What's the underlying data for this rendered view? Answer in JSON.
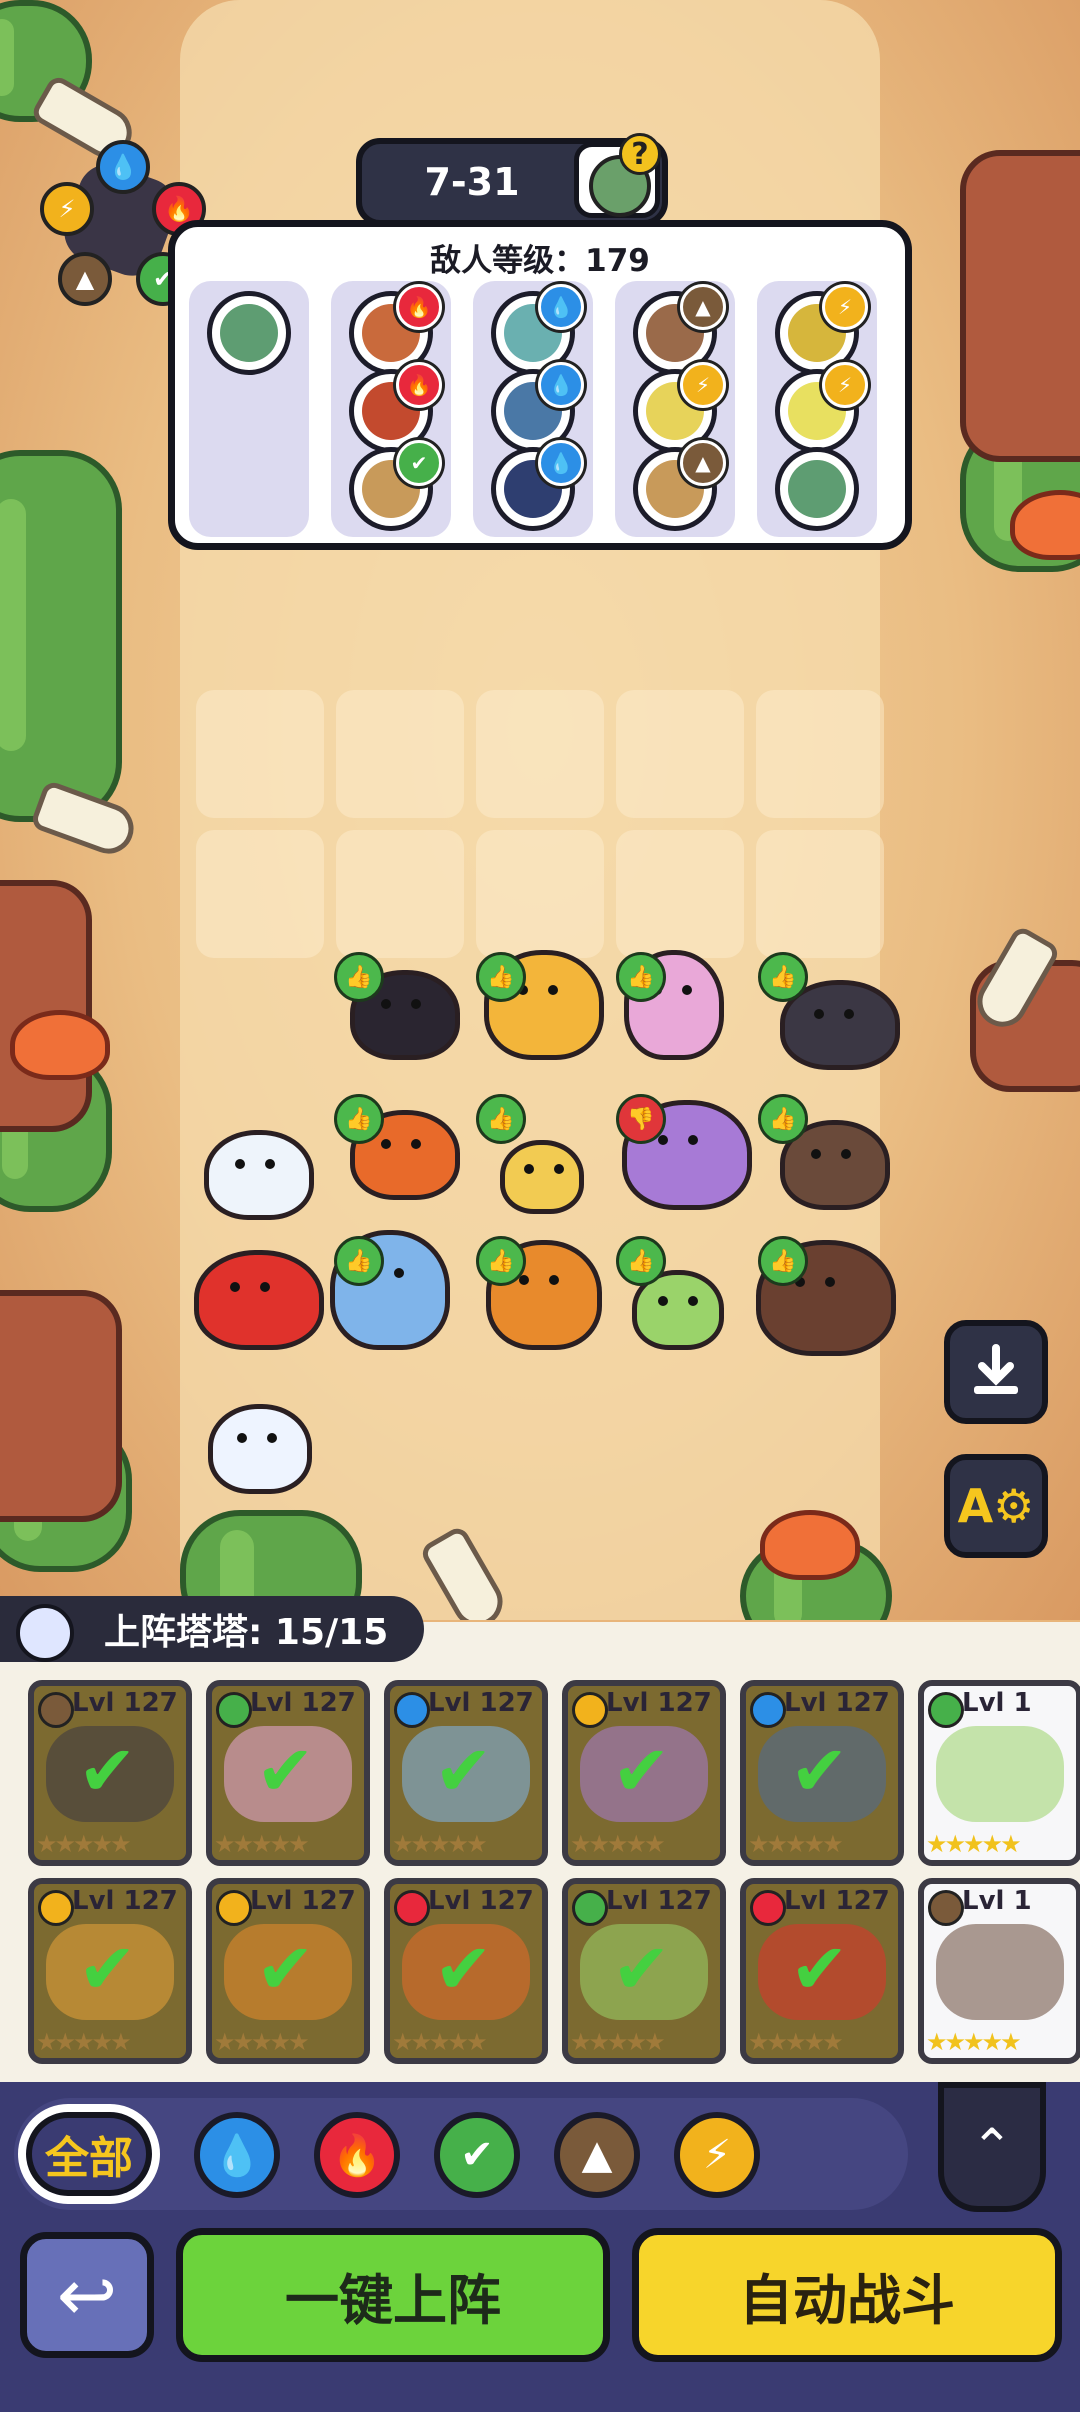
{
  "stage": {
    "label": "7-31",
    "info_icon": "zombie-question-icon"
  },
  "enemy": {
    "level_text": "敌人等级：179",
    "columns": [
      {
        "enemies": [
          {
            "icon": "zombie-green",
            "element": ""
          }
        ]
      },
      {
        "enemies": [
          {
            "icon": "zombie-brown",
            "element": "fire"
          },
          {
            "icon": "zombie-red",
            "element": "fire"
          },
          {
            "icon": "zombie-tan",
            "element": "leaf"
          }
        ]
      },
      {
        "enemies": [
          {
            "icon": "zombie-teal",
            "element": "water"
          },
          {
            "icon": "zombie-blue",
            "element": "water"
          },
          {
            "icon": "zombie-navy",
            "element": "water"
          }
        ]
      },
      {
        "enemies": [
          {
            "icon": "zombie-hat",
            "element": "earth"
          },
          {
            "icon": "zombie-yellow",
            "element": "elec"
          },
          {
            "icon": "zombie-tan",
            "element": "earth"
          }
        ]
      },
      {
        "enemies": [
          {
            "icon": "zombie-crown",
            "element": "elec"
          },
          {
            "icon": "zombie-clown",
            "element": "elec"
          },
          {
            "icon": "zombie-green",
            "element": ""
          }
        ]
      }
    ]
  },
  "element_wheel": [
    "water",
    "fire",
    "leaf",
    "earth",
    "elec"
  ],
  "roster": {
    "title": "上阵塔塔: 15/15",
    "level_label": "Lvl 127",
    "cards_row1": [
      {
        "element": "earth",
        "level": "Lvl 127",
        "selected": true
      },
      {
        "element": "leaf",
        "level": "Lvl 127",
        "selected": true
      },
      {
        "element": "water",
        "level": "Lvl 127",
        "selected": true
      },
      {
        "element": "elec",
        "level": "Lvl 127",
        "selected": true
      },
      {
        "element": "water",
        "level": "Lvl 127",
        "selected": true
      },
      {
        "element": "leaf",
        "level": "Lvl 1",
        "selected": false
      }
    ],
    "cards_row2": [
      {
        "element": "elec",
        "level": "Lvl 127",
        "selected": true
      },
      {
        "element": "elec",
        "level": "Lvl 127",
        "selected": true
      },
      {
        "element": "fire",
        "level": "Lvl 127",
        "selected": true
      },
      {
        "element": "leaf",
        "level": "Lvl 127",
        "selected": true
      },
      {
        "element": "fire",
        "level": "Lvl 127",
        "selected": true
      },
      {
        "element": "earth",
        "level": "Lvl 1",
        "selected": false
      }
    ]
  },
  "filters": {
    "all_label": "全部",
    "elements": [
      "water",
      "fire",
      "leaf",
      "earth",
      "elec"
    ]
  },
  "buttons": {
    "deploy_label": "一键上阵",
    "auto_battle_label": "自动战斗",
    "back_icon": "back-arrow-icon",
    "expand_icon": "chevron-up-icon",
    "save_icon": "download-icon",
    "autoset_icon": "a-gear-icon"
  },
  "colors": {
    "water": "#2c8fe6",
    "fire": "#e8283c",
    "leaf": "#46b04a",
    "earth": "#7a5a3a",
    "elec": "#f2b21c"
  }
}
